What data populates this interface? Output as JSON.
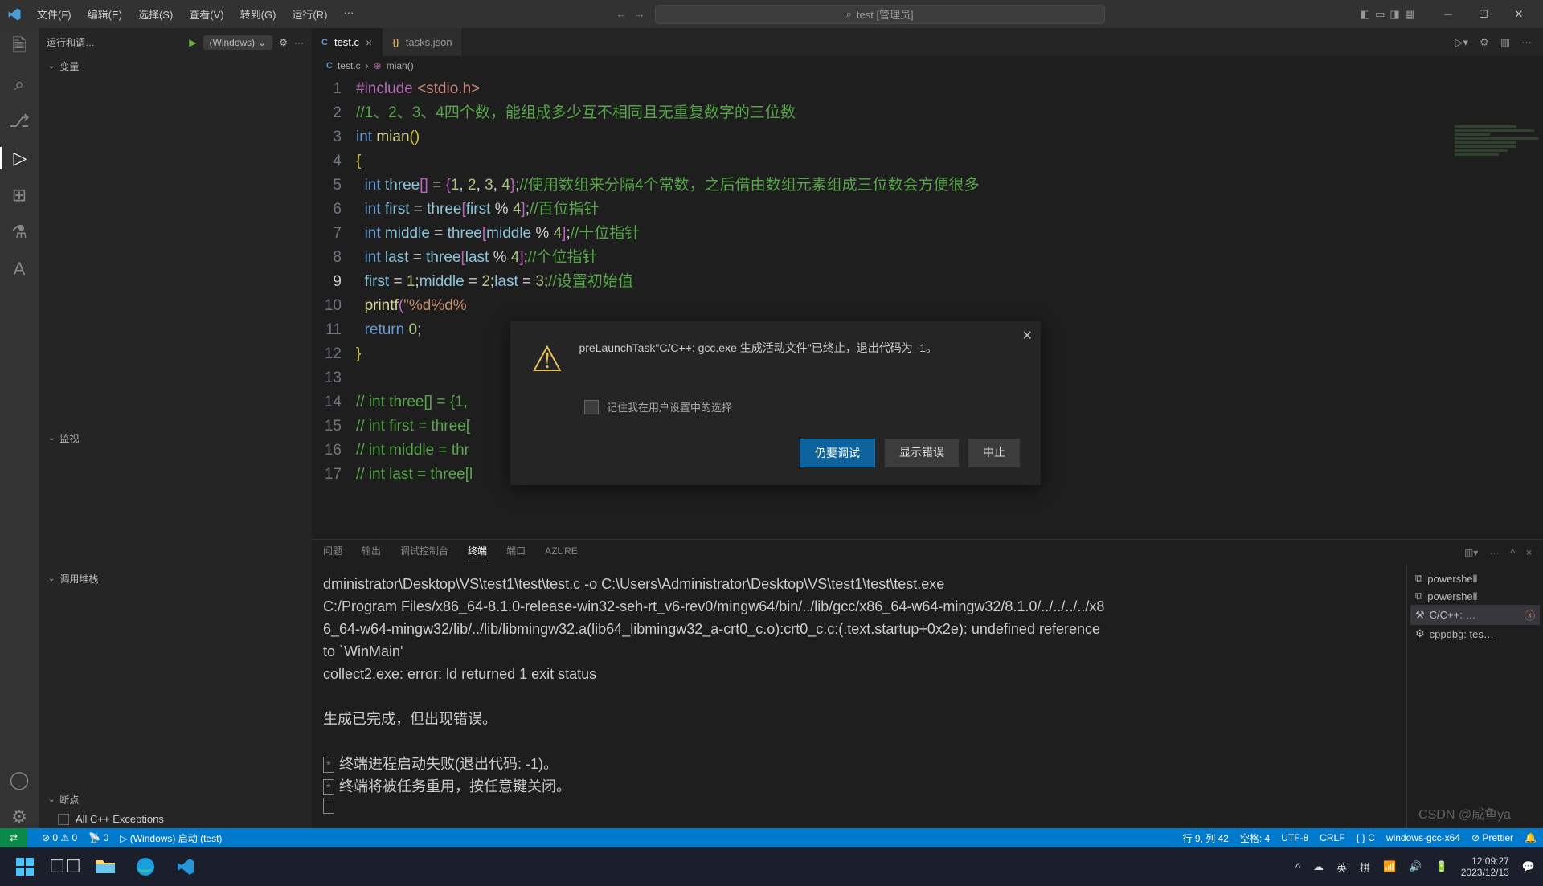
{
  "titlebar": {
    "menus": [
      "文件(F)",
      "编辑(E)",
      "选择(S)",
      "查看(V)",
      "转到(G)",
      "运行(R)",
      "···"
    ],
    "search_label": "test [管理员]"
  },
  "sidebar": {
    "header_title": "运行和调…",
    "config": "(Windows)",
    "sections": {
      "vars": "变量",
      "watch": "监视",
      "callstack": "调用堆栈",
      "breakpoints": "断点"
    },
    "breakpoint_item": "All C++ Exceptions"
  },
  "tabs": {
    "t1": {
      "name": "test.c"
    },
    "t2": {
      "name": "tasks.json"
    }
  },
  "breadcrumb": {
    "file": "test.c",
    "symbol": "mian()"
  },
  "code_lines": [
    {
      "n": 1
    },
    {
      "n": 2
    },
    {
      "n": 3
    },
    {
      "n": 4
    },
    {
      "n": 5
    },
    {
      "n": 6
    },
    {
      "n": 7
    },
    {
      "n": 8
    },
    {
      "n": 9,
      "active": true
    },
    {
      "n": 10
    },
    {
      "n": 11
    },
    {
      "n": 12
    },
    {
      "n": 13
    },
    {
      "n": 14
    },
    {
      "n": 15
    },
    {
      "n": 16
    },
    {
      "n": 17
    }
  ],
  "panel": {
    "tabs": {
      "problems": "问题",
      "output": "输出",
      "debug": "调试控制台",
      "terminal": "终端",
      "ports": "端口",
      "azure": "AZURE"
    }
  },
  "terminal": {
    "l1": "dministrator\\Desktop\\VS\\test1\\test\\test.c -o C:\\Users\\Administrator\\Desktop\\VS\\test1\\test\\test.exe",
    "l2": "C:/Program Files/x86_64-8.1.0-release-win32-seh-rt_v6-rev0/mingw64/bin/../lib/gcc/x86_64-w64-mingw32/8.1.0/../../../../x8",
    "l3": "6_64-w64-mingw32/lib/../lib/libmingw32.a(lib64_libmingw32_a-crt0_c.o):crt0_c.c:(.text.startup+0x2e): undefined reference",
    "l4": "to `WinMain'",
    "l5": "collect2.exe: error: ld returned 1 exit status",
    "l6": "生成已完成，但出现错误。",
    "l7": "终端进程启动失败(退出代码: -1)。",
    "l8": "终端将被任务重用，按任意键关闭。"
  },
  "term_side": {
    "ps1": "powershell",
    "ps2": "powershell",
    "task": "C/C++: …",
    "dbg": "cppdbg: tes…"
  },
  "dialog": {
    "message": "preLaunchTask\"C/C++: gcc.exe 生成活动文件\"已终止，退出代码为 -1。",
    "checkbox": "记住我在用户设置中的选择",
    "btn_debug": "仍要调试",
    "btn_errors": "显示错误",
    "btn_abort": "中止"
  },
  "status": {
    "errors": "0",
    "warnings": "0",
    "ports": "0",
    "launch": "(Windows) 启动 (test)",
    "cursor": "行 9, 列 42",
    "spaces": "空格: 4",
    "enc": "UTF-8",
    "eol": "CRLF",
    "lang": "C",
    "lang_braces": "{ }",
    "intelli": "windows-gcc-x64",
    "prettier": "Prettier"
  },
  "tray": {
    "ime1": "英",
    "ime2": "拼",
    "time": "12:09:27",
    "date": "2023/12/13"
  },
  "watermark": "CSDN @咸鱼ya"
}
